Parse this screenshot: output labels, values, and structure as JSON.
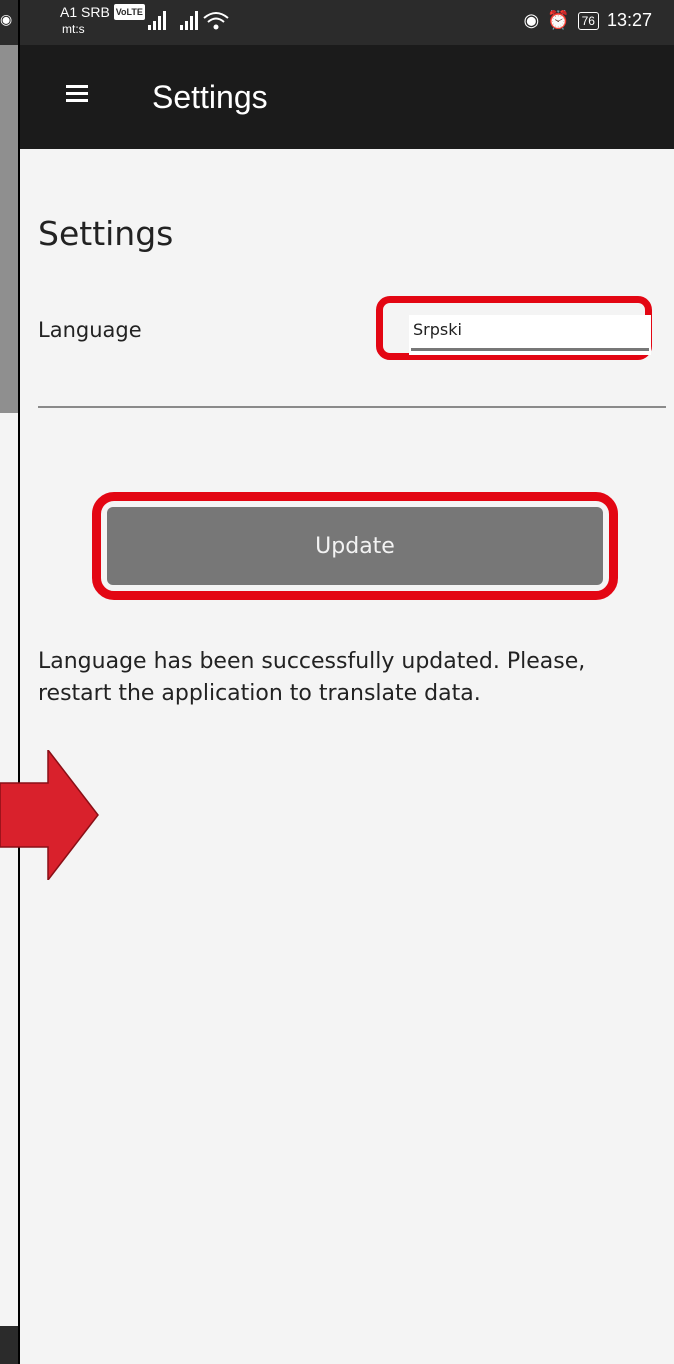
{
  "status_bar": {
    "carrier": "A1 SRB",
    "carrier_badge": "VoLTE",
    "carrier_sub": "mt:s",
    "signal_icons": "signal-bars, signal-bars, wifi",
    "battery": "76",
    "time": "13:27"
  },
  "app_bar": {
    "title": "Settings"
  },
  "settings": {
    "heading": "Settings",
    "language_label": "Language",
    "language_value": "Srpski",
    "update_label": "Update",
    "message": "Language has been successfully updated. Please, restart the application to translate data."
  },
  "colors": {
    "highlight": "#e30613",
    "app_bar": "#1b1b1b",
    "button": "#777777",
    "arrow": "#d9212c"
  }
}
